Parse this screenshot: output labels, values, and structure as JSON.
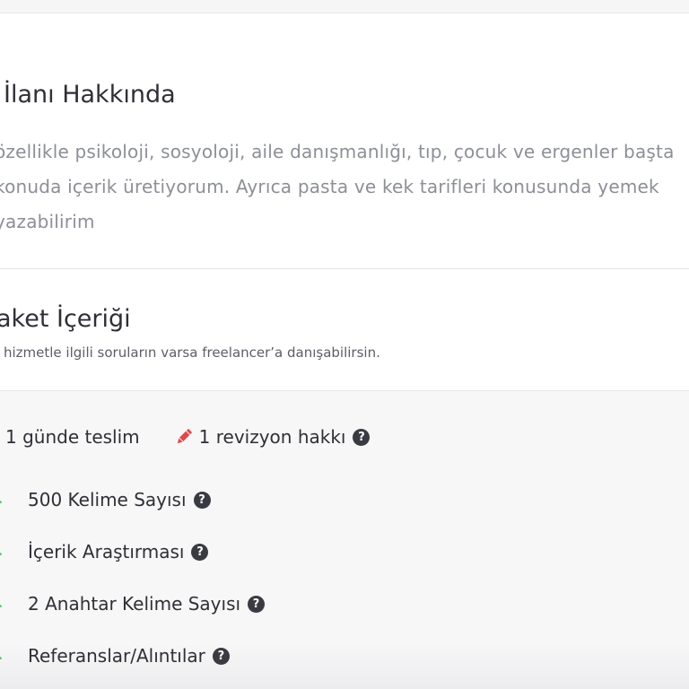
{
  "about": {
    "title": "İlanı Hakkında",
    "lines": [
      "özellikle psikoloji, sosyoloji, aile danışmanlığı, tıp, çocuk ve ergenler başta",
      "konuda içerik üretiyorum. Ayrıca pasta ve kek tarifleri konusunda yemek",
      "yazabilirim"
    ]
  },
  "package": {
    "title": "aket İçeriği",
    "subtitle": "hizmetle ilgili soruların varsa freelancer’a danışabilirsin."
  },
  "meta": {
    "delivery_label": "1 günde teslim",
    "revision_label": "1 revizyon hakkı",
    "help_glyph": "?"
  },
  "features": [
    {
      "label": "500 Kelime Sayısı"
    },
    {
      "label": "İçerik Araştırması"
    },
    {
      "label": "2 Anahtar Kelime Sayısı"
    },
    {
      "label": "Referanslar/Alıntılar"
    }
  ],
  "colors": {
    "accent_pencil": "#e0464e",
    "check_green": "#5cc36a",
    "heading": "#2f2f36",
    "body_gray": "#8d8f97"
  },
  "icons": {
    "revision": "pencil-icon",
    "help": "question-circle-icon",
    "feature": "check-icon"
  }
}
